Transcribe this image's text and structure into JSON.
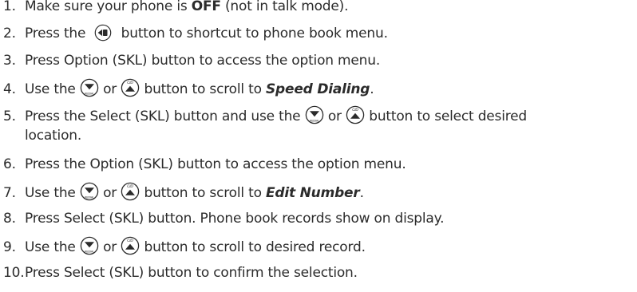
{
  "steps": [
    {
      "num": "1.",
      "a": "Make sure your phone is ",
      "b": "OFF",
      "c": " (not in talk mode)."
    },
    {
      "num": "2.",
      "a": "Press the ",
      "c": " button to shortcut to phone book menu."
    },
    {
      "num": "3.",
      "a": "Press Option (SKL) button to access the option menu."
    },
    {
      "num": "4.",
      "a": "Use the ",
      "or": " or ",
      "c": " button to scroll to ",
      "d": "Speed Dialing",
      "e": "."
    },
    {
      "num": "5.",
      "a": "Press the Select (SKL) button and use the ",
      "or": " or ",
      "c": " button to select desired",
      "cont": "location."
    },
    {
      "num": "6.",
      "a": "Press the Option (SKL) button to access the option menu."
    },
    {
      "num": "7.",
      "a": "Use the ",
      "or": " or ",
      "c": "  button to scroll to ",
      "d": "Edit Number",
      "e": "."
    },
    {
      "num": "8.",
      "a": "Press Select (SKL) button. Phone book records show on display."
    },
    {
      "num": "9.",
      "a": "Use the ",
      "or": " or ",
      "c": " button to scroll to desired record."
    },
    {
      "num": "10.",
      "a": "Press Select (SKL) button to confirm the selection."
    }
  ],
  "icons": {
    "down_label": "REDIAL",
    "up_label": "CID"
  }
}
